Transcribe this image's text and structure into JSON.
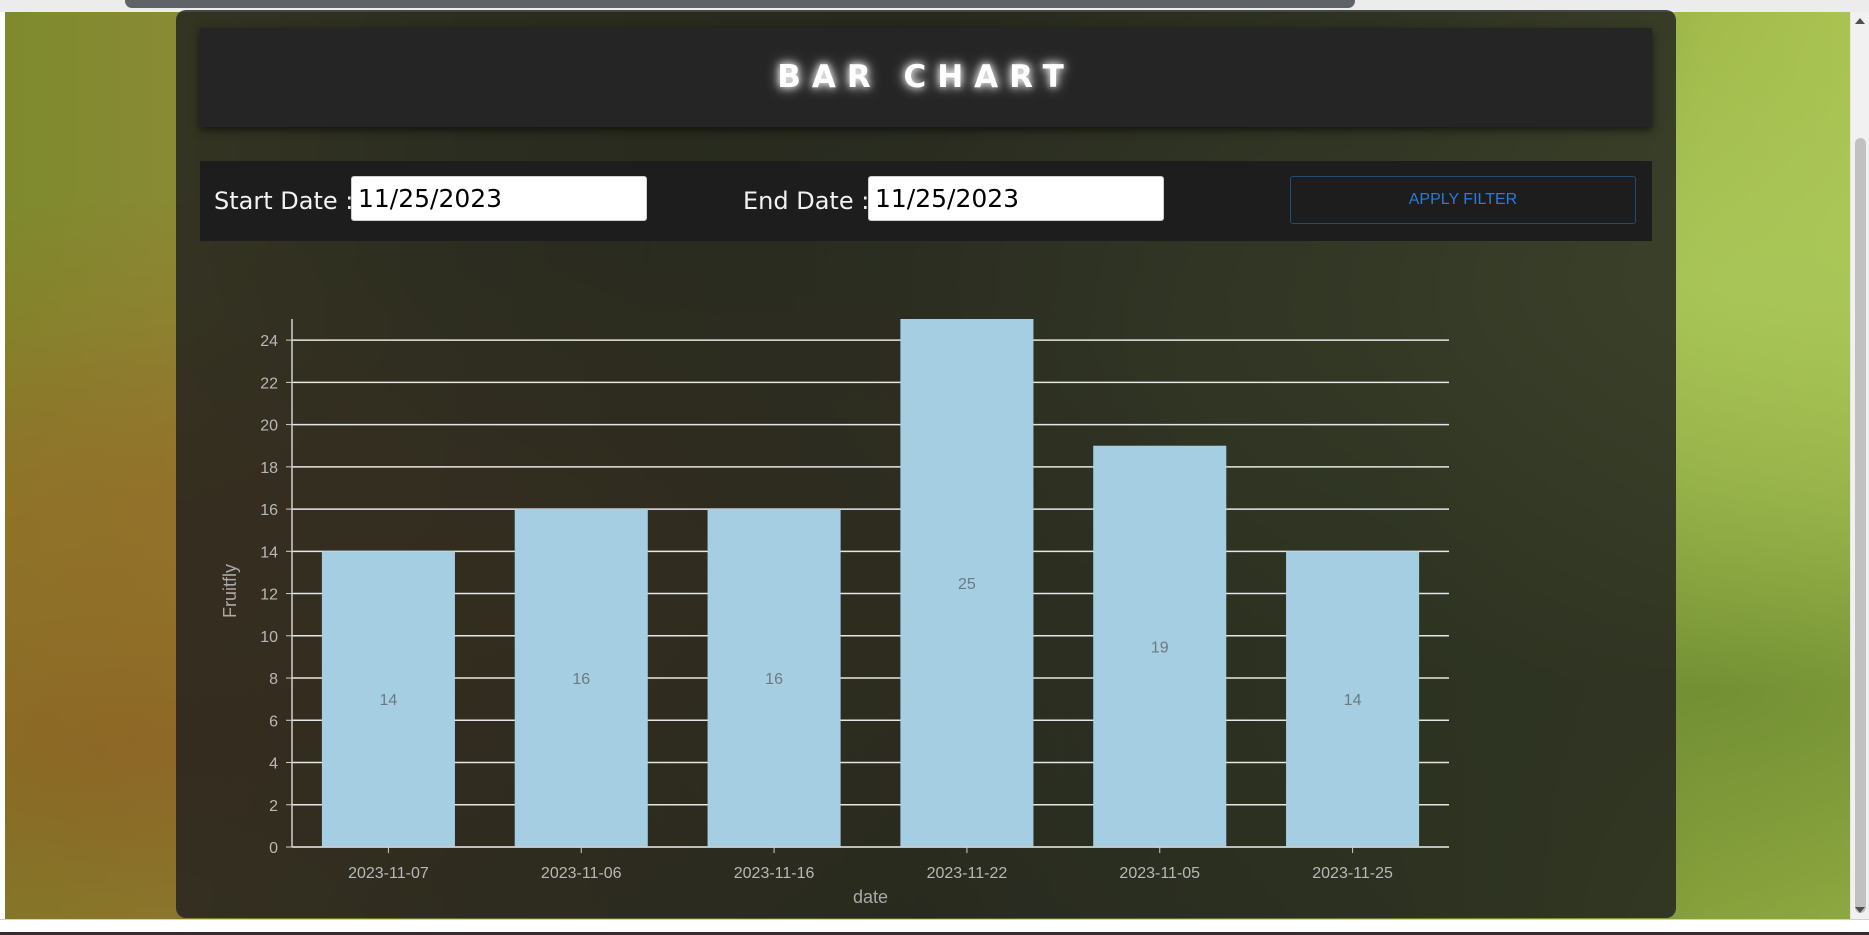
{
  "header": {
    "title": "BAR CHART"
  },
  "filter": {
    "start_label": "Start Date :",
    "start_value": "11/25/2023",
    "end_label": "End Date :",
    "end_value": "11/25/2023",
    "apply_label": "APPLY FILTER"
  },
  "colors": {
    "bar": "#a6cee3",
    "grid": "#e6e6e6",
    "apply_text": "#2a7bd6"
  },
  "chart_data": {
    "type": "bar",
    "categories": [
      "2023-11-07",
      "2023-11-06",
      "2023-11-16",
      "2023-11-22",
      "2023-11-05",
      "2023-11-25"
    ],
    "values": [
      14,
      16,
      16,
      25,
      19,
      14
    ],
    "xlabel": "date",
    "ylabel": "Fruitfly",
    "ylim": [
      0,
      25
    ],
    "yticks": [
      0,
      2,
      4,
      6,
      8,
      10,
      12,
      14,
      16,
      18,
      20,
      22,
      24
    ],
    "grid": true,
    "data_labels": true
  }
}
